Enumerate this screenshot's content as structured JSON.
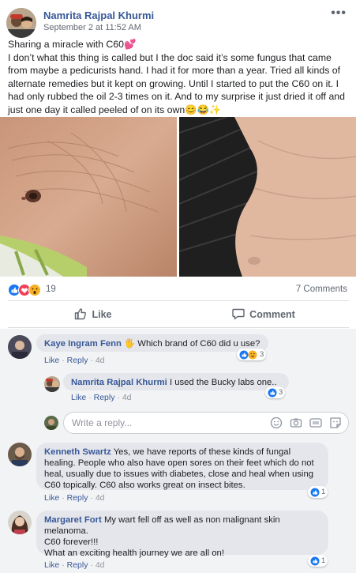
{
  "post": {
    "author": "Namrita Rajpal Khurmi",
    "timestamp": "September 2 at 11:52 AM",
    "more_label": "•••",
    "text_lines": [
      "Sharing a miracle with C60💕",
      "I don’t what this thing is called but I the doc said it’s some fungus that came from maybe a pedicurists hand. I had it for more than a year. Tried all kinds of alternate remedies but it kept on growing. Until I started to put the C60 on it. I had only rubbed the oil 2-3 times on it. And to my surprise it just dried it off and just one day it called peeled of on its own😊😂✨"
    ],
    "reaction_count": "19",
    "comment_count": "7 Comments",
    "like_label": "Like",
    "comment_label": "Comment"
  },
  "comments": [
    {
      "name": "Kaye Ingram Fenn",
      "text": "Which brand of C60 did u use?",
      "emoji": "🖐",
      "like": "Like",
      "reply": "Reply",
      "age": "4d",
      "reactions": "3"
    },
    {
      "name": "Namrita Rajpal Khurmi",
      "text": "I used the Bucky labs one..",
      "like": "Like",
      "reply": "Reply",
      "age": "4d",
      "reactions": "3"
    },
    {
      "name": "Kenneth Swartz",
      "text": "Yes, we have reports of these kinds of fungal healing. People who also have open sores on their feet which do not heal, usually due to issues with diabetes, close and heal when using C60 topically. C60 also works great on insect bites.",
      "like": "Like",
      "reply": "Reply",
      "age": "4d",
      "reactions": "1"
    },
    {
      "name": "Margaret Fort",
      "text_lines": [
        "My wart fell off as well as non malignant skin melanoma.",
        "C60 forever!!!",
        "What an exciting health journey we are all on!"
      ],
      "like": "Like",
      "reply": "Reply",
      "age": "4d",
      "reactions": "1"
    }
  ],
  "reply_box": {
    "placeholder": "Write a reply..."
  },
  "colors": {
    "link_blue": "#385898",
    "like_blue": "#1877f2",
    "love_red": "#f33e58",
    "wow_yellow": "#f7b125"
  },
  "icons": [
    "more-icon",
    "like-reaction-icon",
    "love-reaction-icon",
    "wow-reaction-icon",
    "thumbs-up-icon",
    "speech-bubble-icon",
    "smiley-icon",
    "camera-icon",
    "gif-icon",
    "sticker-icon"
  ]
}
